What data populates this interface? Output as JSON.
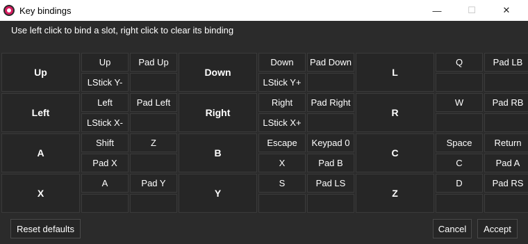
{
  "window": {
    "title": "Key bindings",
    "controls": {
      "minimize": "—",
      "maximize": "☐",
      "close": "✕"
    }
  },
  "hint": "Use left click to bind a slot, right click to clear its binding",
  "bindings": [
    {
      "action": "Up",
      "slots": [
        "Up",
        "Pad Up",
        "LStick Y-",
        ""
      ]
    },
    {
      "action": "Down",
      "slots": [
        "Down",
        "Pad Down",
        "LStick Y+",
        ""
      ]
    },
    {
      "action": "L",
      "slots": [
        "Q",
        "Pad LB",
        "",
        ""
      ]
    },
    {
      "action": "Left",
      "slots": [
        "Left",
        "Pad Left",
        "LStick X-",
        ""
      ]
    },
    {
      "action": "Right",
      "slots": [
        "Right",
        "Pad Right",
        "LStick X+",
        ""
      ]
    },
    {
      "action": "R",
      "slots": [
        "W",
        "Pad RB",
        "",
        ""
      ]
    },
    {
      "action": "A",
      "slots": [
        "Shift",
        "Z",
        "Pad X",
        ""
      ]
    },
    {
      "action": "B",
      "slots": [
        "Escape",
        "Keypad 0",
        "X",
        "Pad B"
      ]
    },
    {
      "action": "C",
      "slots": [
        "Space",
        "Return",
        "C",
        "Pad A"
      ]
    },
    {
      "action": "X",
      "slots": [
        "A",
        "Pad Y",
        "",
        ""
      ]
    },
    {
      "action": "Y",
      "slots": [
        "S",
        "Pad LS",
        "",
        ""
      ]
    },
    {
      "action": "Z",
      "slots": [
        "D",
        "Pad RS",
        "",
        ""
      ]
    }
  ],
  "buttons": {
    "reset": "Reset defaults",
    "cancel": "Cancel",
    "accept": "Accept"
  }
}
